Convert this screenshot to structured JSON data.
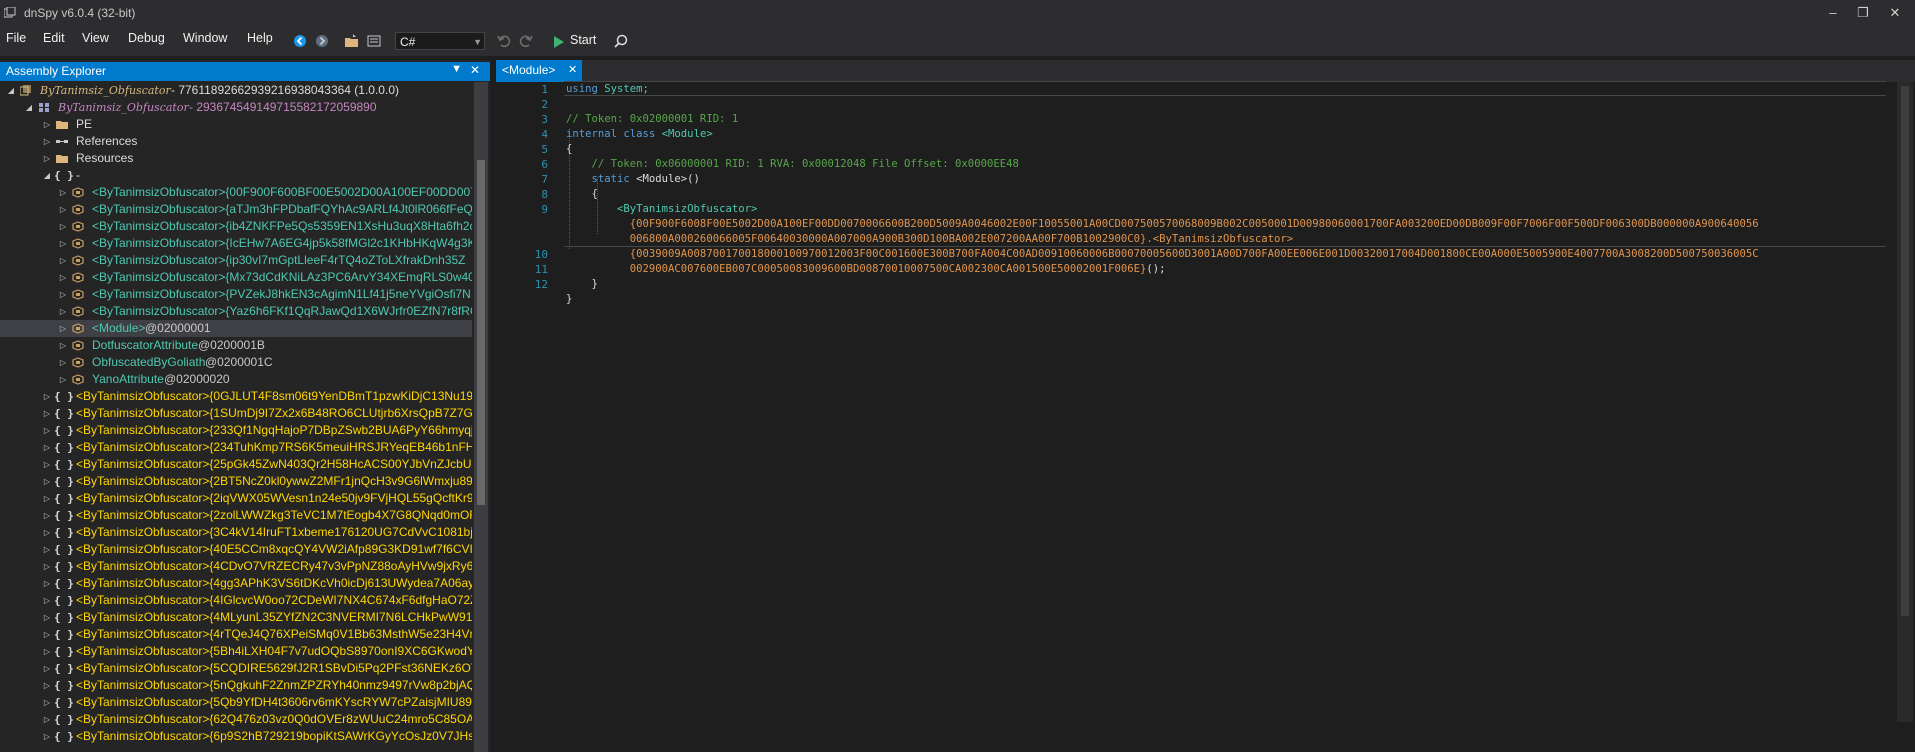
{
  "window": {
    "title": "dnSpy v6.0.4 (32-bit)",
    "controls": [
      "minimize",
      "maximize",
      "close"
    ]
  },
  "menu": {
    "items": [
      "File",
      "Edit",
      "View",
      "Debug",
      "Window",
      "Help"
    ]
  },
  "toolbar": {
    "language": "C#",
    "start_label": "Start",
    "icons": [
      "back-icon",
      "forward-icon",
      "open-icon",
      "open-list-icon",
      "undo-icon",
      "redo-icon",
      "start-icon",
      "search-icon"
    ]
  },
  "explorer": {
    "title": "Assembly Explorer",
    "tree": [
      {
        "label": "ByTanimsiz_Obfuscator",
        "token": " - 7761189266293921693804​3364 (1.0.0.0)",
        "level": 0,
        "icon": "assembly",
        "color": "asm",
        "expanded": true
      },
      {
        "label": "ByTanimsiz_Obfuscator",
        "token": " - 2936745491497155821720​59890",
        "level": 1,
        "icon": "module",
        "color": "mod",
        "expanded": true
      },
      {
        "label": "PE",
        "token": "",
        "level": 2,
        "icon": "folder",
        "color": "white",
        "expanded": false
      },
      {
        "label": "References",
        "token": "",
        "level": 2,
        "icon": "references",
        "color": "white",
        "expanded": false
      },
      {
        "label": "Resources",
        "token": "",
        "level": 2,
        "icon": "folder",
        "color": "white",
        "expanded": false
      },
      {
        "label": "-",
        "token": "",
        "level": 2,
        "icon": "namespace",
        "color": "white",
        "expanded": true
      },
      {
        "label": "<ByTanimsizObfuscator>{00F900F600BF00E5002D00A100EF00DD007000",
        "token": "",
        "level": 3,
        "icon": "class",
        "color": "cls"
      },
      {
        "label": "<ByTanimsizObfuscator>{aTJm3hFPDbafFQYhAc9ARLf4Jt0lR066fFeQG",
        "token": "",
        "level": 3,
        "icon": "class",
        "color": "cls"
      },
      {
        "label": "<ByTanimsizObfuscator>{ib4ZNKFPe5Qs5359EN1XsHu3uqX8Hta6fh2cl",
        "token": "",
        "level": 3,
        "icon": "class",
        "color": "cls"
      },
      {
        "label": "<ByTanimsizObfuscator>{IcEHw7A6EG4jp5k58fMGl2c1KHbHKqW4g3K",
        "token": "",
        "level": 3,
        "icon": "class",
        "color": "cls"
      },
      {
        "label": "<ByTanimsizObfuscator>{ip30vI7mGptLleeF4rTQ4oZToLXfrakDnh35Z",
        "token": "",
        "level": 3,
        "icon": "class",
        "color": "cls"
      },
      {
        "label": "<ByTanimsizObfuscator>{Mx73dCdKNiLAz3PC6ArvY34XEmqRLS0w40U",
        "token": "",
        "level": 3,
        "icon": "class",
        "color": "cls"
      },
      {
        "label": "<ByTanimsizObfuscator>{PVZekJ8hkEN3cAgimN1Lf41j5neYVgiOsfi7N",
        "token": "",
        "level": 3,
        "icon": "class",
        "color": "cls"
      },
      {
        "label": "<ByTanimsizObfuscator>{Yaz6h6FKf1QqRJawQd1X6WJrfr0EZfN7r8fRC",
        "token": "",
        "level": 3,
        "icon": "class",
        "color": "cls"
      },
      {
        "label": "<Module>",
        "token": " @02000001",
        "level": 3,
        "icon": "class",
        "color": "cls",
        "selected": true
      },
      {
        "label": "DotfuscatorAttribute",
        "token": " @0200001B",
        "level": 3,
        "icon": "class",
        "color": "cls"
      },
      {
        "label": "ObfuscatedByGoliath",
        "token": " @0200001C",
        "level": 3,
        "icon": "class",
        "color": "cls"
      },
      {
        "label": "YanoAttribute",
        "token": " @02000020",
        "level": 3,
        "icon": "class",
        "color": "cls"
      },
      {
        "label": "<ByTanimsizObfuscator>{0GJLUT4F8sm06t9YenDBmT1pzwKiDjC13Nu19si",
        "token": "",
        "level": 2,
        "icon": "namespace",
        "color": "ns"
      },
      {
        "label": "<ByTanimsizObfuscator>{1SUmDj9I7Zx2x6B48RO6CLUtjrb6XrsQpB7Z7GRfP",
        "token": "",
        "level": 2,
        "icon": "namespace",
        "color": "ns"
      },
      {
        "label": "<ByTanimsizObfuscator>{233Qf1NgqHajoP7DBpZSwb2BUA6PyY66hmyqjC",
        "token": "",
        "level": 2,
        "icon": "namespace",
        "color": "ns"
      },
      {
        "label": "<ByTanimsizObfuscator>{234TuhKmp7RS6K5meuiHRSJRYeqEB46b1nFH13",
        "token": "",
        "level": 2,
        "icon": "namespace",
        "color": "ns"
      },
      {
        "label": "<ByTanimsizObfuscator>{25pGk45ZwN403Qr2H58HcACS00YJbVnZJcbUZR",
        "token": "",
        "level": 2,
        "icon": "namespace",
        "color": "ns"
      },
      {
        "label": "<ByTanimsizObfuscator>{2BT5NcZ0kl0ywwZ2MFr1jnQcH3v9G6lWmxju893",
        "token": "",
        "level": 2,
        "icon": "namespace",
        "color": "ns"
      },
      {
        "label": "<ByTanimsizObfuscator>{2iqVWX05WVesn1n24e50jv9FVjHQL55gQcftKr9e",
        "token": "",
        "level": 2,
        "icon": "namespace",
        "color": "ns"
      },
      {
        "label": "<ByTanimsizObfuscator>{2zolLWWZkg3TeVC1M7tEogb4X7G8QNqd0mOR",
        "token": "",
        "level": 2,
        "icon": "namespace",
        "color": "ns"
      },
      {
        "label": "<ByTanimsizObfuscator>{3C4kV14IruFT1xbeme176120UG7CdVvC1081bjop",
        "token": "",
        "level": 2,
        "icon": "namespace",
        "color": "ns"
      },
      {
        "label": "<ByTanimsizObfuscator>{40E5CCm8xqcQY4VW2iAfp89G3KD91wf7f6CVIhi",
        "token": "",
        "level": 2,
        "icon": "namespace",
        "color": "ns"
      },
      {
        "label": "<ByTanimsizObfuscator>{4CDvO7VRZECRy47v3vPpNZ88oAyHVw9jxRy6KV",
        "token": "",
        "level": 2,
        "icon": "namespace",
        "color": "ns"
      },
      {
        "label": "<ByTanimsizObfuscator>{4gg3APhK3VS6tDKcVh0icDj613UWydea7A06ayX",
        "token": "",
        "level": 2,
        "icon": "namespace",
        "color": "ns"
      },
      {
        "label": "<ByTanimsizObfuscator>{4IGlcvcW0oo72CDeWI7NX4C674xF6dfgHaO72Zg",
        "token": "",
        "level": 2,
        "icon": "namespace",
        "color": "ns"
      },
      {
        "label": "<ByTanimsizObfuscator>{4MLyunL35ZYfZN2C3NVERMI7N6LCHkPwW91n",
        "token": "",
        "level": 2,
        "icon": "namespace",
        "color": "ns"
      },
      {
        "label": "<ByTanimsizObfuscator>{4rTQeJ4Q76XPeiSMq0V1Bb63MsthW5e23H4Vnk",
        "token": "",
        "level": 2,
        "icon": "namespace",
        "color": "ns"
      },
      {
        "label": "<ByTanimsizObfuscator>{5Bh4iLXH04F7v7udOQbS8970onI9XC6GKwodYg",
        "token": "",
        "level": 2,
        "icon": "namespace",
        "color": "ns"
      },
      {
        "label": "<ByTanimsizObfuscator>{5CQDIRE5629fJ2R1SBvDi5Pq2PFst36NEKz6OTPV",
        "token": "",
        "level": 2,
        "icon": "namespace",
        "color": "ns"
      },
      {
        "label": "<ByTanimsizObfuscator>{5nQgkuhF2ZnmZPZRYh40nmz9497rVw8p2bjAQ",
        "token": "",
        "level": 2,
        "icon": "namespace",
        "color": "ns"
      },
      {
        "label": "<ByTanimsizObfuscator>{5Qb9YfDH4t3606rv6mKYscRYW7cPZaisjMIU893a",
        "token": "",
        "level": 2,
        "icon": "namespace",
        "color": "ns"
      },
      {
        "label": "<ByTanimsizObfuscator>{62Q476z03vz0Q0dOVEr8zWUuC24mro5C85OAKD",
        "token": "",
        "level": 2,
        "icon": "namespace",
        "color": "ns"
      },
      {
        "label": "<ByTanimsizObfuscator>{6p9S2hB729219bopiKtSAWrKGyYcOsJz0V7JHs6u",
        "token": "",
        "level": 2,
        "icon": "namespace",
        "color": "ns"
      }
    ]
  },
  "editor": {
    "tab_label": "<Module>",
    "line_numbers": [
      "1",
      "2",
      "3",
      "4",
      "5",
      "6",
      "7",
      "8",
      "9",
      "",
      "",
      "10",
      "11",
      "12"
    ],
    "code": {
      "l1_kw": "using",
      "l1_rest": " System;",
      "l3": "// Token: 0x02000001 RID: 1",
      "l4_kw": "internal class",
      "l4_ty": " <Module>",
      "l5": "{",
      "l6": "    // Token: 0x06000001 RID: 1 RVA: 0x00012048 File Offset: 0x0000EE48",
      "l7_kw": "    static",
      "l7_rest": " <Module>()",
      "l8": "    {",
      "l9_name": "        <ByTanimsizObfuscator>",
      "l9a": "          {00F900F6008F00E5002D00A100EF00DD0070006600B200D5009A0046002E00F10055001A00CD007500570068009B002C0050001D00980060001700FA003200ED00DB009F00F7006F00F500DF006300DB000000A900640056",
      "l9b": "          006800A000260066005F00640030000A007000A900B300D100BA002E007200AA00F700B1002900C0}",
      "l9b_call": ".<ByTanimsizObfuscator>",
      "l9c": "          {0039009A008700170018000100970012003F00C001600E300B700FA004C00AD00910060006B00070005600D3001A00D700FA00EE006E001D00320017004D001800CE00A000E5005900E4007700A3008200D500750036005C",
      "l9d": "          002900AC007600EB007C00050083009600BD00870010007500CA002300CA001500E50002001F006E}",
      "l9d_end": "();",
      "l10": "    }",
      "l11": "}"
    }
  },
  "colors": {
    "accent": "#007acc",
    "namespace_text": "#ffd700",
    "class_text": "#4ec9b0",
    "keyword": "#569cd6",
    "comment": "#57a64a",
    "line_number": "#2b91af"
  }
}
